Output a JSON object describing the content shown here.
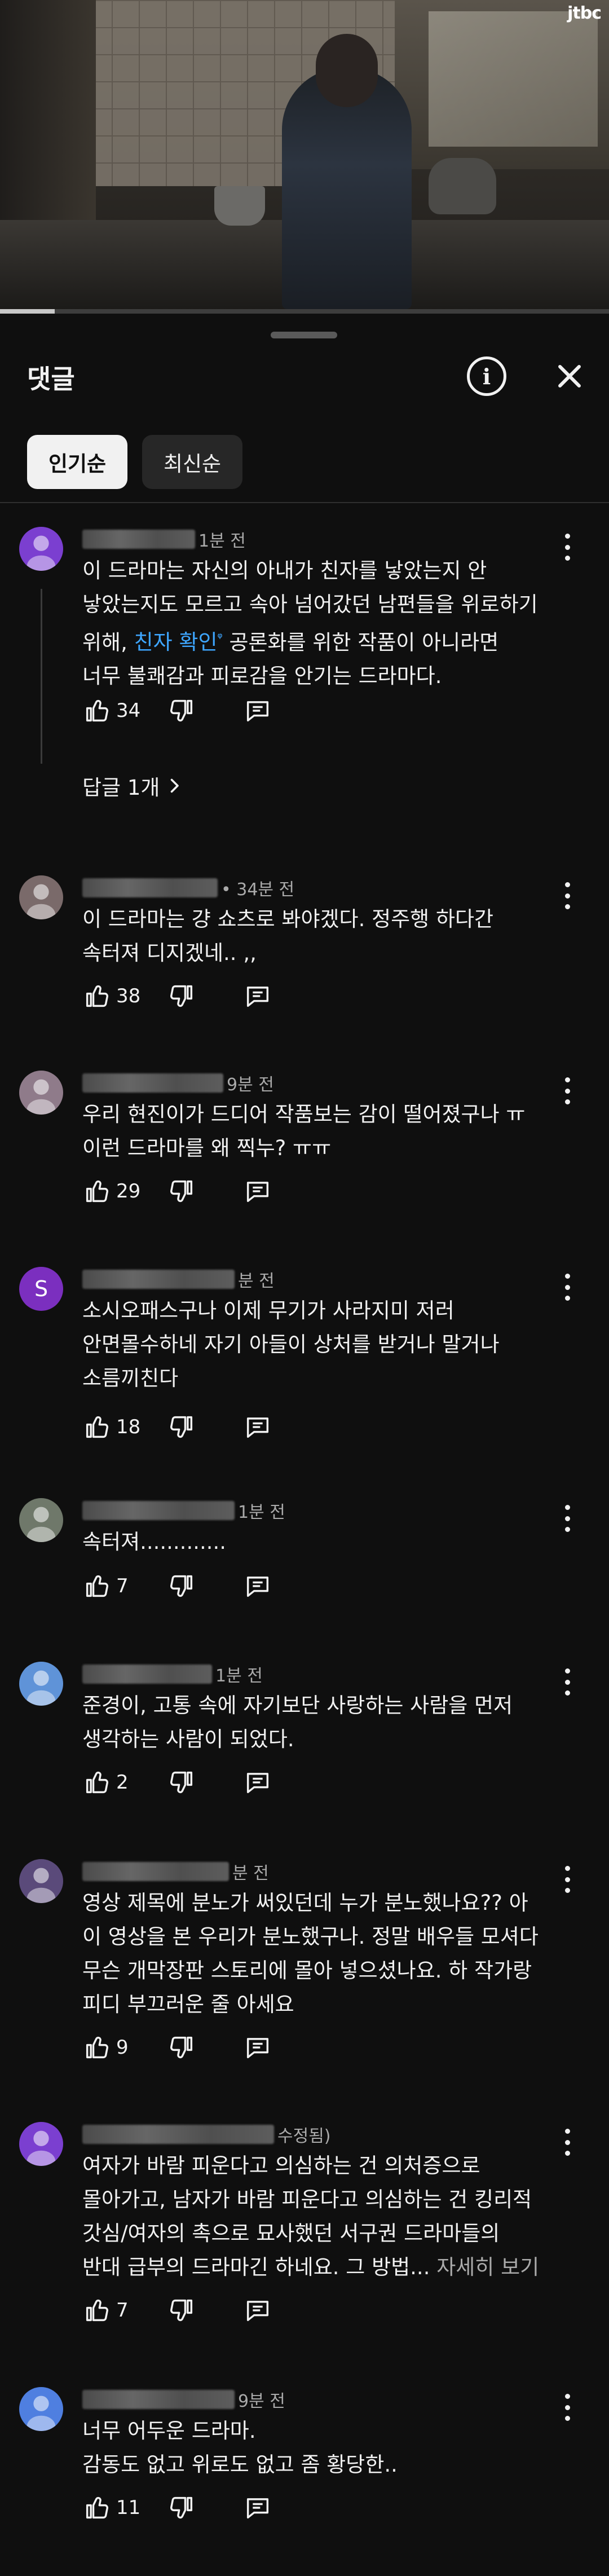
{
  "video": {
    "watermark": "JTBC",
    "progress": 0.09
  },
  "panel": {
    "title": "댓글",
    "sort_tabs": [
      {
        "label": "인기순",
        "active": true
      },
      {
        "label": "최신순",
        "active": false
      }
    ]
  },
  "comments": [
    {
      "meta": "1분 전",
      "avatar_color": "#7b3fd0",
      "lines": [
        "이 드라마는 자신의 아내가 친자를 낳았는지 안",
        "낳았는지도 모르고 속아 넘어갔던 남편들을 위로하기"
      ],
      "line3_pre": "위해, ",
      "link": "친자 확인",
      "line3_post": " 공론화를 위한 작품이 아니라면",
      "line4": "너무 불쾌감과 피로감을 안기는 드라마다.",
      "likes": "34",
      "replies": "답글 1개"
    },
    {
      "meta": "• 34분 전",
      "avatar_color": "#7a6a6a",
      "lines": [
        "이 드라마는 걍 쇼츠로 봐야겠다. 정주행 하다간",
        "속터져 디지겠네.. ,,"
      ],
      "likes": "38"
    },
    {
      "meta": "9분 전",
      "avatar_color": "#8f7b8a",
      "lines": [
        "우리 현진이가 드디어 작품보는 감이 떨어졌구나 ㅠ",
        "이런 드라마를 왜 찍누? ㅠㅠ"
      ],
      "likes": "29"
    },
    {
      "meta": "분 전",
      "avatar_letter": "S",
      "avatar_color": "#7b2fbf",
      "lines": [
        "소시오패스구나 이제 무기가 사라지미 저러",
        "안면몰수하네 자기 아들이 상처를 받거나 말거나",
        "소름끼친다"
      ],
      "likes": "18"
    },
    {
      "meta": "1분 전",
      "avatar_color": "#6f786a",
      "lines": [
        "속터져............."
      ],
      "likes": "7"
    },
    {
      "meta": "1분 전",
      "avatar_color": "#5f93d8",
      "lines": [
        "준경이, 고통 속에 자기보단 사랑하는 사람을 먼저",
        "생각하는 사람이 되었다."
      ],
      "likes": "2"
    },
    {
      "meta": "분 전",
      "avatar_color": "#5a4a7a",
      "lines": [
        "영상 제목에 분노가 써있던데 누가 분노했나요?? 아",
        "이 영상을 본 우리가 분노했구나. 정말 배우들 모셔다",
        "무슨 개막장판 스토리에 몰아 넣으셨나요. 하 작가랑",
        "피디 부끄러운 줄 아세요"
      ],
      "likes": "9"
    },
    {
      "meta": "수정됨)",
      "avatar_color": "#7b3fd0",
      "lines": [
        "여자가 바람 피운다고 의심하는 건 의처증으로",
        "몰아가고, 남자가 바람 피운다고 의심하는 건 킹리적",
        "갓심/여자의 촉으로 묘사했던 서구권 드라마들의"
      ],
      "line4_pre": "반대 급부의 드라마긴 하네요. 그 방법... ",
      "more": "자세히 보기",
      "likes": "7"
    },
    {
      "meta": "9분 전",
      "avatar_color": "#4f7fe0",
      "lines": [
        "너무 어두운 드라마.",
        "감동도 없고 위로도 없고 좀 황당한.."
      ],
      "likes": "11"
    }
  ]
}
